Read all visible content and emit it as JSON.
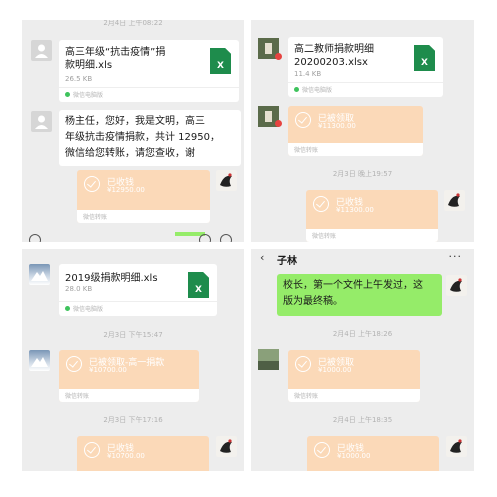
{
  "panel1": {
    "timestamp": "2月4日 上午08:22",
    "file": {
      "name_line1": "高三年级“抗击疫情”捐",
      "name_line2": "款明细.xls",
      "size": "26.5 KB",
      "source": "微信电脑版",
      "icon_letter": "X"
    },
    "message": {
      "line1": "杨主任，您好，我是文明，高三",
      "line2": "年级抗击疫情捐款，共计 12950，",
      "line3": "微信给您转账，请您查收，谢"
    },
    "transfer": {
      "status": "已收钱",
      "amount": "¥12950.00",
      "source": "微信转账"
    }
  },
  "panel2": {
    "file": {
      "name_line1": "高二教师捐款明细",
      "name_line2": "20200203.xlsx",
      "size": "11.4 KB",
      "source": "微信电脑版",
      "icon_letter": "X"
    },
    "transfer1": {
      "status": "已被领取",
      "amount": "¥11300.00",
      "source": "微信转账"
    },
    "timestamp": "2月3日 晚上19:57",
    "transfer2": {
      "status": "已收钱",
      "amount": "¥11300.00",
      "source": "微信转账"
    }
  },
  "panel3": {
    "file": {
      "name_line1": "2019级捐款明细.xls",
      "size": "28.0 KB",
      "source": "微信电脑版",
      "icon_letter": "X"
    },
    "timestamp1": "2月3日 下午15:47",
    "transfer1": {
      "status": "已被领取-高一捐款",
      "amount": "¥10700.00",
      "source": "微信转账"
    },
    "timestamp2": "2月3日 下午17:16",
    "transfer2": {
      "status": "已收钱",
      "amount": "¥10700.00",
      "source": "微信转账"
    }
  },
  "panel4": {
    "header": {
      "back": "‹",
      "title": "子林",
      "more": "···"
    },
    "message": {
      "line1": "校长，第一个文件上午发过，这",
      "line2": "版为最终稿。"
    },
    "timestamp1": "2月4日 上午18:26",
    "transfer1": {
      "status": "已被领取",
      "amount": "¥1000.00",
      "source": "微信转账"
    },
    "timestamp2": "2月4日 上午18:35",
    "transfer2": {
      "status": "已收钱",
      "amount": "¥1000.00",
      "source": "微信转账"
    }
  },
  "colors": {
    "chat_bg": "#ededed",
    "transfer": "#fbd9b8",
    "green_bubble": "#95ec69",
    "excel": "#1e8c4c"
  }
}
